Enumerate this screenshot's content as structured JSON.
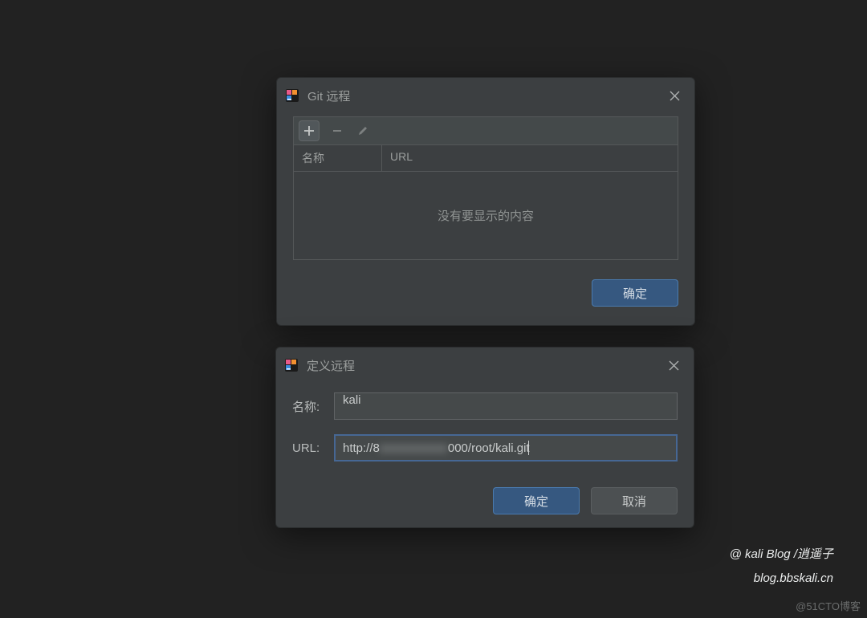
{
  "dialog1": {
    "title": "Git 远程",
    "columns": {
      "name": "名称",
      "url": "URL"
    },
    "empty": "没有要显示的内容",
    "ok": "确定"
  },
  "dialog2": {
    "title": "定义远程",
    "name_label": "名称:",
    "url_label": "URL:",
    "name_value": "kali",
    "url_prefix": "http://8",
    "url_mid_obscured": "xxxxxxxxxx",
    "url_suffix": "000/root/kali.git",
    "ok": "确定",
    "cancel": "取消"
  },
  "credits": {
    "line1": "@ kali Blog /逍遥子",
    "line2": "blog.bbskali.cn"
  },
  "watermark": "@51CTO博客",
  "icons": {
    "app": "intellij-icon",
    "close": "close-icon",
    "add": "plus-icon",
    "remove": "minus-icon",
    "edit": "pencil-icon"
  }
}
